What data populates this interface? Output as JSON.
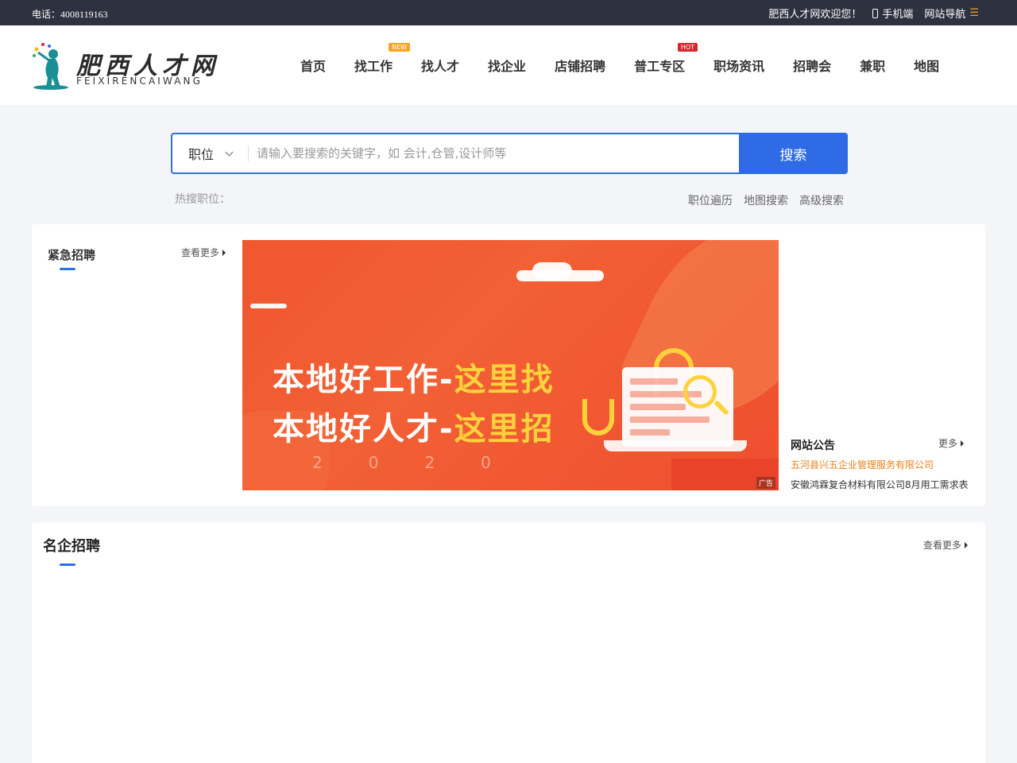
{
  "topbar": {
    "phone_label": "电话：",
    "phone_number": "4008119163",
    "welcome": "肥西人才网欢迎您！",
    "mobile": "手机端",
    "site_nav": "网站导航"
  },
  "logo": {
    "cn": "肥西人才网",
    "en": "FEIXIRENCAIWANG"
  },
  "nav": [
    {
      "label": "首页",
      "badge": ""
    },
    {
      "label": "找工作",
      "badge": "NEW"
    },
    {
      "label": "找人才",
      "badge": ""
    },
    {
      "label": "找企业",
      "badge": ""
    },
    {
      "label": "店铺招聘",
      "badge": ""
    },
    {
      "label": "普工专区",
      "badge": "HOT"
    },
    {
      "label": "职场资讯",
      "badge": ""
    },
    {
      "label": "招聘会",
      "badge": ""
    },
    {
      "label": "兼职",
      "badge": ""
    },
    {
      "label": "地图",
      "badge": ""
    }
  ],
  "search": {
    "type": "职位",
    "placeholder": "请输入要搜索的关键字，如 会计,仓管,设计师等",
    "button": "搜索",
    "hot_label": "热搜职位：",
    "links": [
      "职位遍历",
      "地图搜索",
      "高级搜索"
    ]
  },
  "urgent": {
    "title": "紧急招聘",
    "more": "查看更多"
  },
  "banner": {
    "line1_a": "本地好工作-",
    "line1_b": "这里找",
    "line2_a": "本地好人才-",
    "line2_b": "这里招",
    "year": "2020",
    "ad": "广告"
  },
  "notice": {
    "title": "网站公告",
    "more": "更多",
    "items": [
      "五河县兴五企业管理服务有限公司",
      "安徽鸿霖复合材料有限公司8月用工需求表"
    ]
  },
  "famous": {
    "title": "名企招聘",
    "more": "查看更多"
  },
  "colors": {
    "accent": "#2f6be5",
    "topbar": "#2e3240",
    "notice_highlight": "#e8821a",
    "banner": "#f0572f"
  }
}
